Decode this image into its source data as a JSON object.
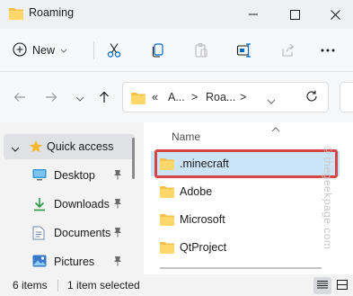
{
  "window": {
    "title": "Roaming"
  },
  "toolbar": {
    "new_label": "New",
    "icons": [
      "cut-icon",
      "copy-icon",
      "paste-icon",
      "rename-icon",
      "share-icon",
      "more-icon"
    ]
  },
  "address": {
    "overflow": "«",
    "crumbs": [
      "A...",
      "Roa..."
    ],
    "separator": ">"
  },
  "sidebar": {
    "items": [
      {
        "label": "Quick access",
        "icon": "star-icon"
      },
      {
        "label": "Desktop",
        "icon": "desktop-icon"
      },
      {
        "label": "Downloads",
        "icon": "download-icon"
      },
      {
        "label": "Documents",
        "icon": "document-icon"
      },
      {
        "label": "Pictures",
        "icon": "picture-icon"
      }
    ]
  },
  "content": {
    "column_name": "Name",
    "items": [
      ".minecraft",
      "Adobe",
      "Microsoft",
      "QtProject"
    ]
  },
  "watermark": "©thegeekpage.com",
  "status": {
    "item_count": "6 items",
    "selected": "1 item selected"
  },
  "colors": {
    "folder": "#f2c14e",
    "selection": "#cce4f7",
    "highlight_border": "#d64545",
    "accent": "#0067c0"
  }
}
